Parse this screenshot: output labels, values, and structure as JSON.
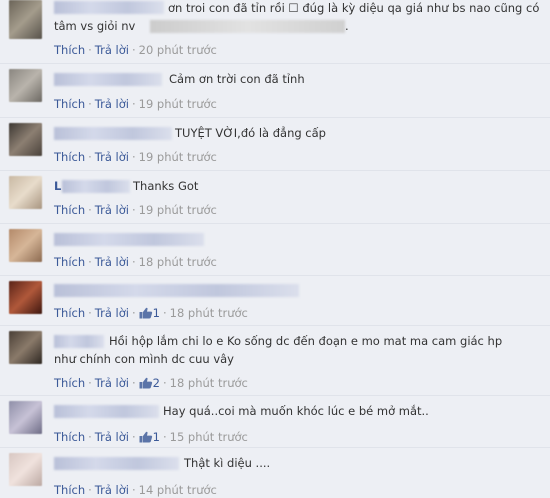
{
  "ui": {
    "reply_label": "Thích",
    "answer_label": "Trả lời",
    "separator": "·"
  },
  "comments": [
    {
      "text_lines": [
        "ơn troi con đã tỉn rồi ☐ đúg là kỳ diệu qa giá như bs nao cũng có",
        "tâm vs giỏi nv"
      ],
      "time": "20 phút trước",
      "likes": null,
      "trailing": "."
    },
    {
      "text_lines": [
        "Cảm ơn trời con đã tỉnh"
      ],
      "time": "19 phút trước",
      "likes": null
    },
    {
      "text_lines": [
        "TUYỆT VỜI,đó là đẳng cấp"
      ],
      "time": "19 phút trước",
      "likes": null
    },
    {
      "text_lines": [
        "Thanks Got"
      ],
      "time": "19 phút trước",
      "likes": null,
      "name_prefix": "L"
    },
    {
      "text_lines": [],
      "time": "18 phút trước",
      "likes": null
    },
    {
      "text_lines": [],
      "time": "18 phút trước",
      "likes": "1"
    },
    {
      "text_lines": [
        "Hồi hộp lắm chi lo e Ko sống dc đến đoạn e mo mat ma cam giác hp",
        "như chính con mình dc cuu vây"
      ],
      "time": "18 phút trước",
      "likes": "2"
    },
    {
      "text_lines": [
        "Hay quá..coi mà muốn khóc lúc e bé mở mắt.."
      ],
      "time": "15 phút trước",
      "likes": "1"
    },
    {
      "text_lines": [
        "Thật kì diệu ...."
      ],
      "time": "14 phút trước",
      "likes": null
    }
  ]
}
